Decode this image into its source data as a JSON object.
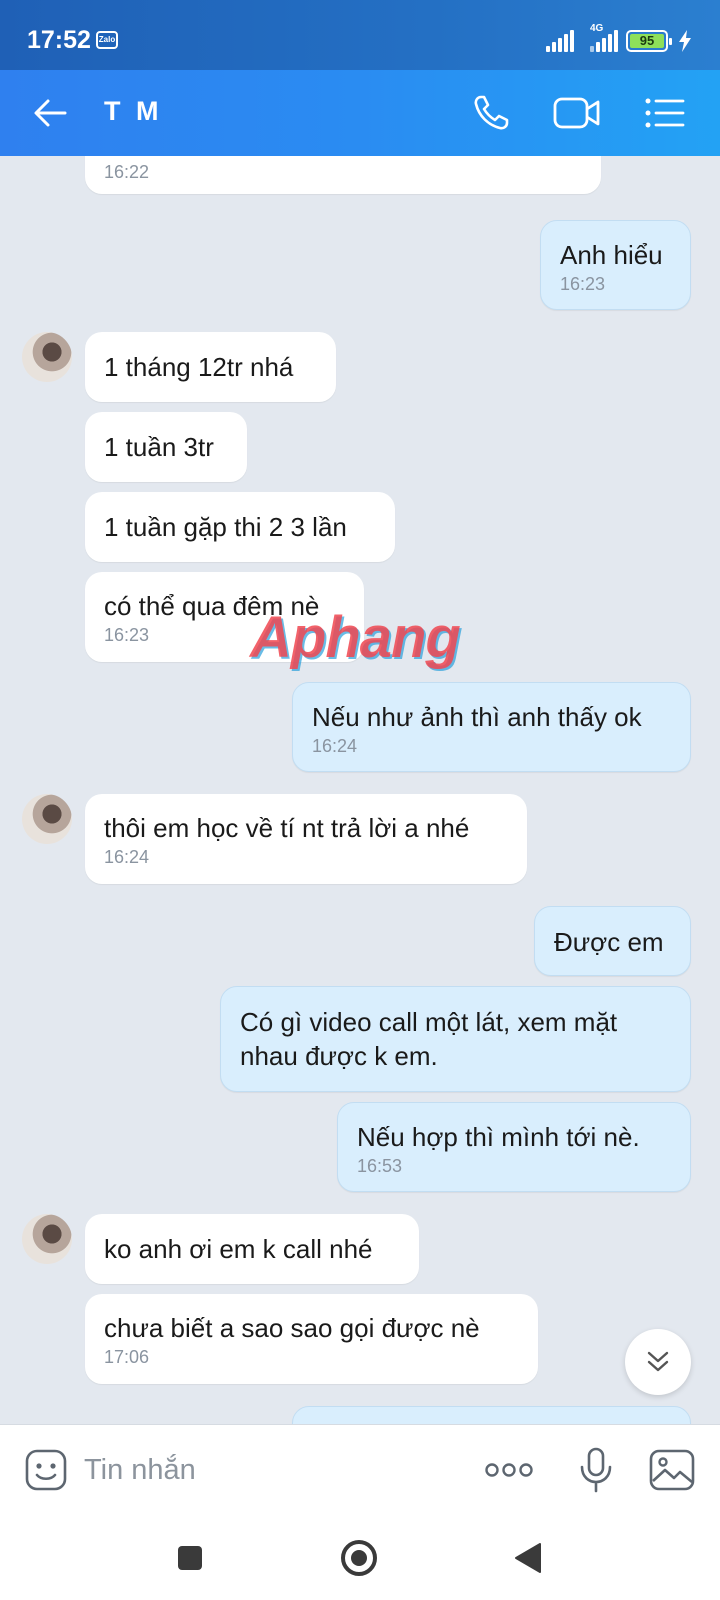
{
  "status": {
    "time": "17:52",
    "app_badge": "Zalo",
    "network": "4G",
    "battery": "95"
  },
  "header": {
    "title": "T M"
  },
  "messages": [
    {
      "text": "",
      "time": "16:22"
    },
    {
      "text": "Anh hiểu",
      "time": "16:23"
    },
    {
      "text": "1 tháng 12tr nhá"
    },
    {
      "text": "1 tuần 3tr"
    },
    {
      "text": "1 tuần gặp thi 2 3 lần"
    },
    {
      "text": "có thể qua đêm nè",
      "time": "16:23"
    },
    {
      "text": "Nếu như ảnh thì anh thấy ok",
      "time": "16:24"
    },
    {
      "text": "thôi em học về tí nt trả lời a nhé",
      "time": "16:24"
    },
    {
      "text": "Được em"
    },
    {
      "text": "Có gì video call một lát, xem mặt nhau được k em."
    },
    {
      "text": "Nếu hợp thì mình tới nè.",
      "time": "16:53"
    },
    {
      "text": "ko anh ơi em k call nhé"
    },
    {
      "text": "chưa biết a sao sao gọi được nè",
      "time": "17:06"
    }
  ],
  "watermark": "Aphang",
  "input": {
    "placeholder": "Tin nhắn"
  },
  "icons": {
    "back": "arrow-left-icon",
    "call": "phone-icon",
    "video": "video-camera-icon",
    "menu": "list-menu-icon",
    "sticker": "smiley-sticker-icon",
    "more": "more-dots-icon",
    "mic": "microphone-icon",
    "image": "image-icon",
    "scroll": "chevron-double-down-icon"
  }
}
